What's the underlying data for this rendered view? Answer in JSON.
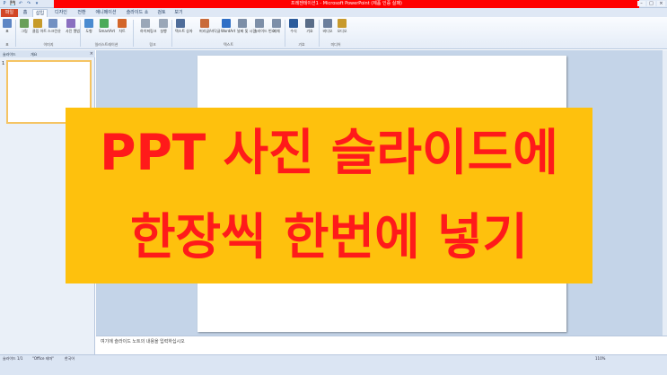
{
  "titlebar": {
    "title": "프레젠테이션1 - Microsoft PowerPoint (제품 인증 실패)",
    "qat": [
      "P",
      "💾",
      "↶",
      "↷",
      "▾"
    ],
    "window_buttons": [
      "–",
      "□",
      "×"
    ]
  },
  "tabs": {
    "file": "파일",
    "items": [
      "홈",
      "삽입",
      "디자인",
      "전환",
      "애니메이션",
      "슬라이드 쇼",
      "검토",
      "보기"
    ]
  },
  "ribbon": {
    "buttons": [
      {
        "label": "표",
        "color": "#5d86c4"
      },
      {
        "label": "그림",
        "color": "#6aa05a"
      },
      {
        "label": "클립 아트",
        "color": "#c79b2a"
      },
      {
        "label": "스크린샷",
        "color": "#7290c2"
      },
      {
        "label": "사진 앨범",
        "color": "#8a6fc0"
      },
      {
        "label": "도형",
        "color": "#4a8bd0"
      },
      {
        "label": "SmartArt",
        "color": "#4cab5a"
      },
      {
        "label": "차트",
        "color": "#d3662a"
      },
      {
        "label": "하이퍼링크",
        "color": "#9aa7b8"
      },
      {
        "label": "실행",
        "color": "#9aa7b8"
      },
      {
        "label": "텍스트 상자",
        "color": "#4f6d9a"
      },
      {
        "label": "머리글/바닥글",
        "color": "#c96b3a"
      },
      {
        "label": "WordArt",
        "color": "#2f6fc6"
      },
      {
        "label": "날짜 및 시간",
        "color": "#7d8fa8"
      },
      {
        "label": "슬라이드 번호",
        "color": "#7d8fa8"
      },
      {
        "label": "개체",
        "color": "#7d8fa8"
      },
      {
        "label": "수식",
        "color": "#2c5c9c"
      },
      {
        "label": "기호",
        "color": "#5a6d88"
      },
      {
        "label": "비디오",
        "color": "#6c7f9c"
      },
      {
        "label": "오디오",
        "color": "#c89a2c"
      }
    ],
    "groups": [
      "표",
      "이미지",
      "일러스트레이션",
      "링크",
      "텍스트",
      "기호",
      "미디어"
    ]
  },
  "pane": {
    "tabs": [
      "슬라이드",
      "개요"
    ],
    "close": "×",
    "slide_number": "1"
  },
  "notes": {
    "placeholder": "여기에 슬라이드 노트의 내용을 입력하십시오"
  },
  "status": {
    "slide": "슬라이드 1/1",
    "theme": "\"Office 테마\"",
    "language": "한국어",
    "zoom": "110%"
  },
  "banner": {
    "line1": "PPT 사진 슬라이드에",
    "line2": "한장씩 한번에 넣기",
    "background": "#fec10d",
    "text_color": "#ff1a1a"
  }
}
